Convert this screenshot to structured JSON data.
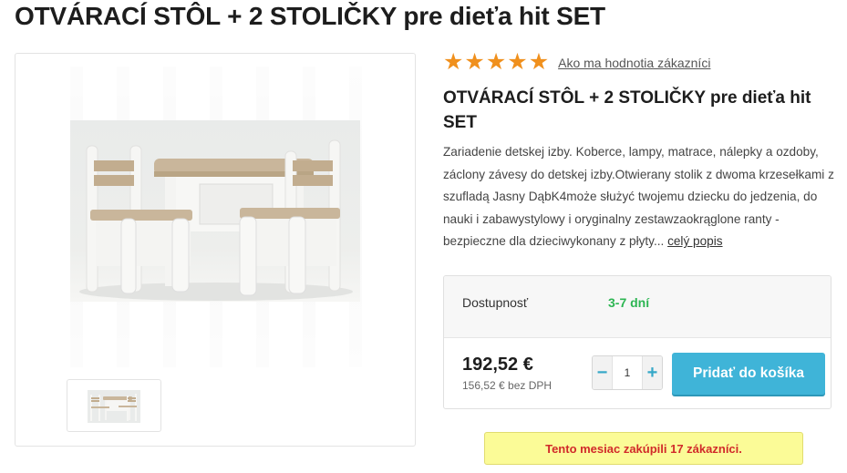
{
  "page": {
    "title": "OTVÁRACÍ STÔL + 2 STOLIČKY pre dieťa hit SET"
  },
  "rating": {
    "stars": 5,
    "max_stars": 5,
    "star_glyph": "★",
    "link_label": "Ako ma hodnotia zákazníci",
    "color": "#f0901d"
  },
  "product": {
    "name": "OTVÁRACÍ STÔL + 2 STOLIČKY pre dieťa hit SET",
    "description": "Zariadenie detskej izby. Koberce, lampy, matrace, nálepky a ozdoby, záclony závesy do detskej izby.Otwierany stolik z dwoma krzesełkami z szufladą Jasny DąbK4może służyć twojemu dziecku do jedzenia, do nauki i zabawystylowy i oryginalny zestawzaokrąglone ranty - bezpieczne dla dzieciwykonany z płyty...",
    "more_link": "celý popis",
    "image_icon": "table-with-chairs-photo"
  },
  "availability": {
    "label": "Dostupnosť",
    "value": "3-7 dní",
    "color": "#2cb552"
  },
  "pricing": {
    "price": "192,52 €",
    "price_net": "156,52 € bez DPH"
  },
  "quantity": {
    "value": "1",
    "minus_label": "−",
    "plus_label": "+"
  },
  "cart": {
    "add_label": "Pridať do košíka",
    "color": "#3fb4d8"
  },
  "notice": {
    "text": "Tento mesiac zakúpili 17 zákazníci.",
    "background": "#fbfb97",
    "color": "#d12a2a"
  }
}
